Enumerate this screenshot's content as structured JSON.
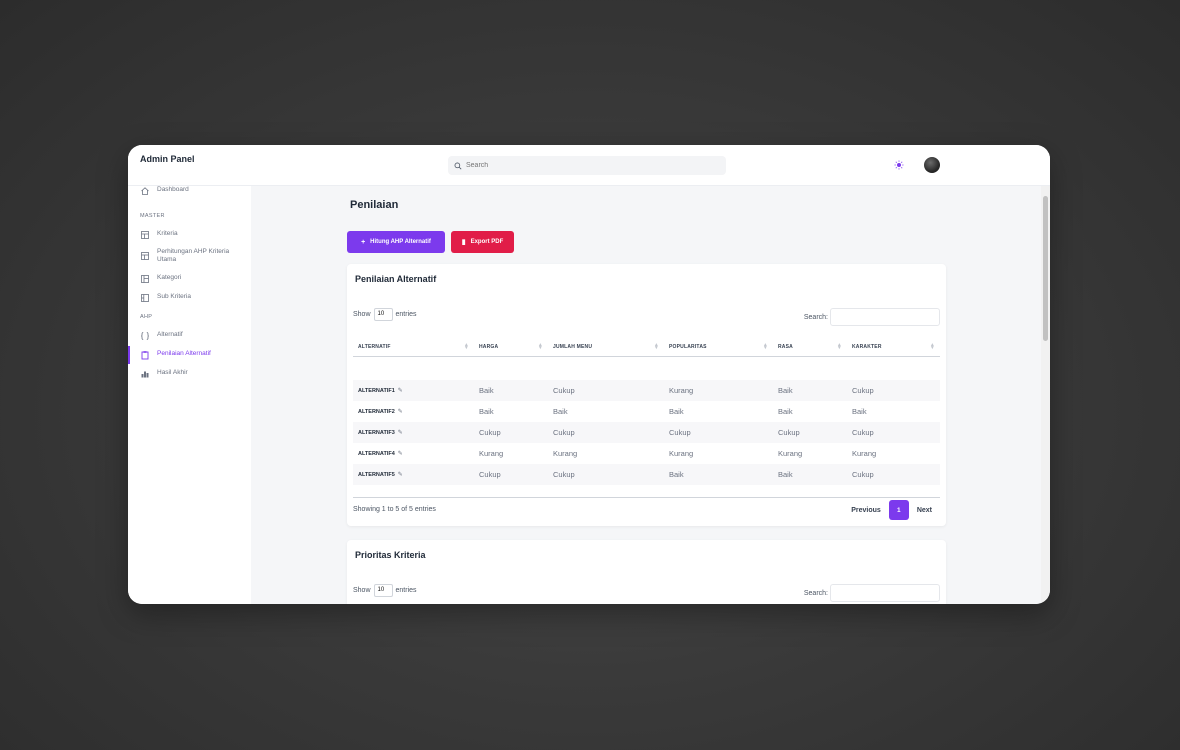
{
  "topbar": {
    "title": "Admin Panel",
    "search_placeholder": "Search"
  },
  "sidebar": {
    "dashboard": "Dashboard",
    "section_master": "MASTER",
    "kriteria": "Kriteria",
    "perhitungan": "Perhitungan AHP Kriteria Utama",
    "kategori": "Kategori",
    "sub_kriteria": "Sub Kriteria",
    "section_ahp": "AHP",
    "alternatif": "Alternatif",
    "penilaian_alternatif": "Penilaian Alternatif",
    "hasil_akhir": "Hasil Akhir"
  },
  "main": {
    "page_title": "Penilaian",
    "btn_hitung": "Hitung AHP Alternatif",
    "btn_export": "Export PDF"
  },
  "card1": {
    "title": "Penilaian Alternatif",
    "show_prefix": "Show",
    "show_value": "10",
    "show_suffix": "entries",
    "search_label": "Search:",
    "columns": [
      "ALTERNATIF",
      "HARGA",
      "JUMLAH MENU",
      "POPULARITAS",
      "RASA",
      "KARAKTER"
    ],
    "rows": [
      [
        "ALTERNATIF1",
        "Baik",
        "Cukup",
        "Kurang",
        "Baik",
        "Cukup"
      ],
      [
        "ALTERNATIF2",
        "Baik",
        "Baik",
        "Baik",
        "Baik",
        "Baik"
      ],
      [
        "ALTERNATIF3",
        "Cukup",
        "Cukup",
        "Cukup",
        "Cukup",
        "Cukup"
      ],
      [
        "ALTERNATIF4",
        "Kurang",
        "Kurang",
        "Kurang",
        "Kurang",
        "Kurang"
      ],
      [
        "ALTERNATIF5",
        "Cukup",
        "Cukup",
        "Baik",
        "Baik",
        "Cukup"
      ]
    ],
    "showing": "Showing 1 to 5 of 5 entries",
    "prev": "Previous",
    "page": "1",
    "next": "Next"
  },
  "card2": {
    "title": "Prioritas Kriteria",
    "show_prefix": "Show",
    "show_value": "10",
    "show_suffix": "entries",
    "search_label": "Search:"
  },
  "colors": {
    "accent": "#7c3aed",
    "danger": "#e11d48"
  }
}
